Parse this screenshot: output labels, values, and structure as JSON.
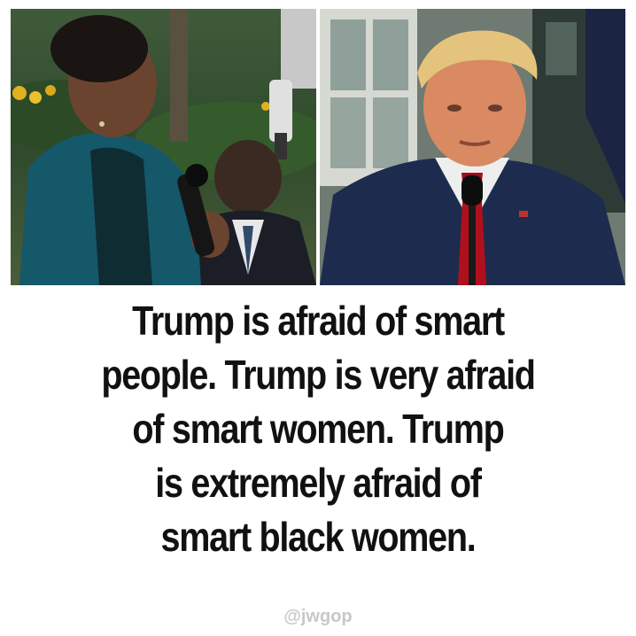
{
  "caption": {
    "lines": [
      "Trump is afraid of smart",
      "people. Trump is very afraid",
      "of smart women. Trump",
      "is extremely afraid of",
      "smart black women."
    ]
  },
  "credit": "@jwgop",
  "colors": {
    "background": "#ffffff",
    "caption_text": "#111111",
    "credit_text": "#c8c8c8"
  }
}
